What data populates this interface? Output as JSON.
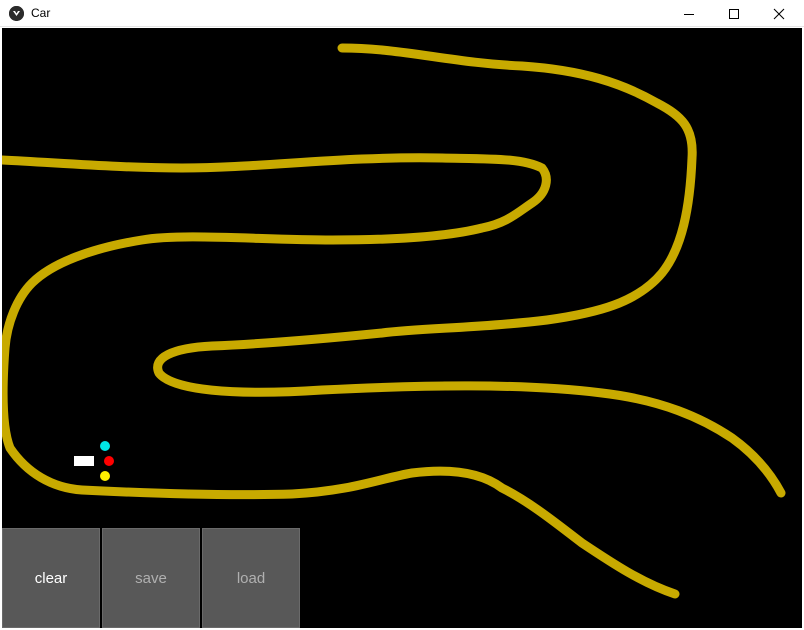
{
  "window": {
    "title": "Car"
  },
  "controls": {
    "clear_label": "clear",
    "save_label": "save",
    "load_label": "load"
  },
  "colors": {
    "background": "#000000",
    "road": "#c8aa00",
    "car": "#ffffff",
    "sensor_top": "#00e5e5",
    "sensor_mid": "#ff0000",
    "sensor_bottom": "#ffee00",
    "button": "#585858"
  }
}
